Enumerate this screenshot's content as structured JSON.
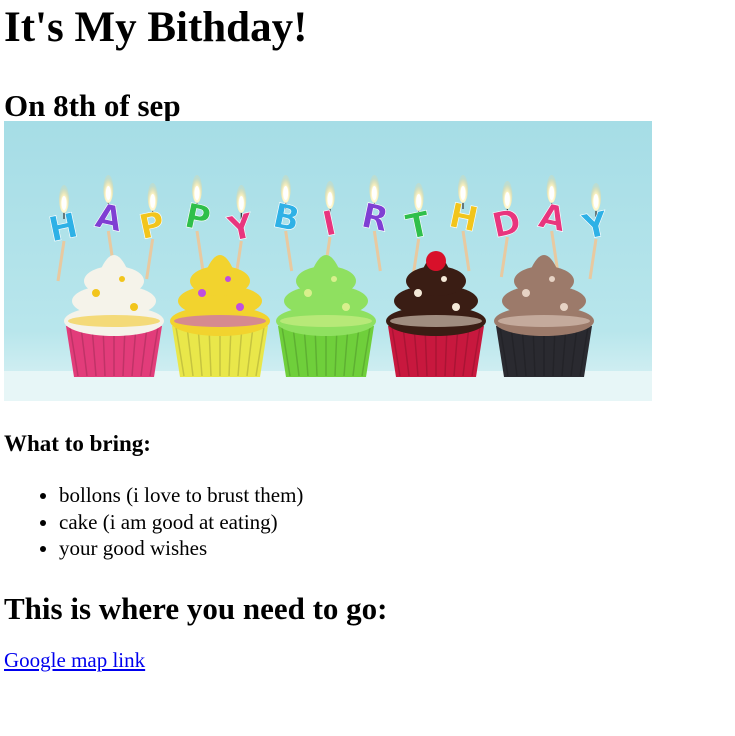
{
  "page": {
    "title": "It's My Bithday!",
    "date_heading": "On 8th of sep",
    "banner": {
      "word": [
        "H",
        "A",
        "P",
        "P",
        "Y",
        "B",
        "I",
        "R",
        "T",
        "H",
        "D",
        "A",
        "Y"
      ],
      "letter_colors": [
        "#2eb1e6",
        "#7f3fd3",
        "#f2c51c",
        "#2fbf4a",
        "#e8357e",
        "#2eb1e6",
        "#e8357e",
        "#7f3fd3",
        "#2fbf4a",
        "#f2c51c",
        "#e8357e",
        "#e8357e",
        "#2eb1e6"
      ],
      "background": "#a9dfe6",
      "cupcakes": [
        {
          "frosting": "#f5f3ea",
          "wrapper": "#e23c7a",
          "accent": "#f2c51c"
        },
        {
          "frosting": "#f2d32e",
          "wrapper": "#e9e74a",
          "accent": "#c04fe0"
        },
        {
          "frosting": "#8fe060",
          "wrapper": "#6fcf3b",
          "accent": "#d8f08c"
        },
        {
          "frosting": "#3a1d14",
          "wrapper": "#c8183e",
          "accent": "#f4e9d8"
        },
        {
          "frosting": "#9c7a6a",
          "wrapper": "#2a2a30",
          "accent": "#e6d2c4"
        }
      ]
    },
    "bring_heading": "What to bring:",
    "bring_items": [
      "bollons (i love to brust them)",
      "cake (i am good at eating)",
      "your good wishes"
    ],
    "go_heading": "This is where you need to go:",
    "map_link_text": "Google map link"
  }
}
